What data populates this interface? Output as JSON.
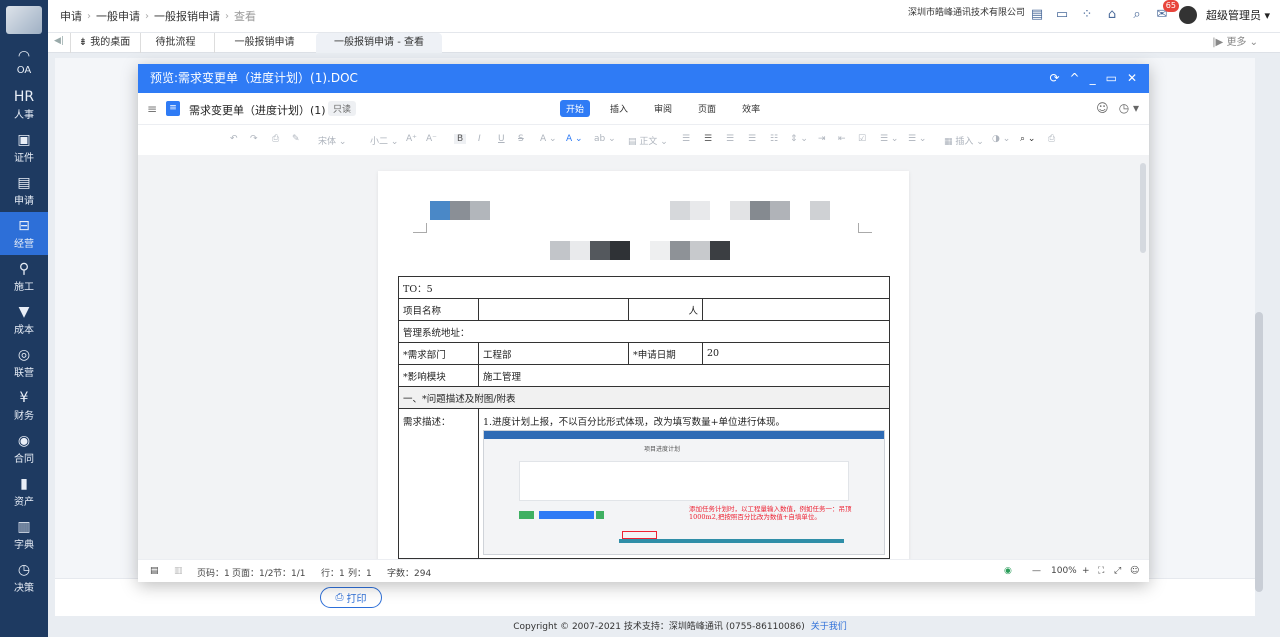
{
  "nav": [
    {
      "label": "OA",
      "icon": "oa-icon"
    },
    {
      "label": "人事",
      "icon": "hr-icon"
    },
    {
      "label": "证件",
      "icon": "certificate-icon"
    },
    {
      "label": "申请",
      "icon": "apply-icon"
    },
    {
      "label": "经营",
      "icon": "business-icon",
      "active": true
    },
    {
      "label": "施工",
      "icon": "construction-icon"
    },
    {
      "label": "成本",
      "icon": "cost-icon"
    },
    {
      "label": "联营",
      "icon": "alliance-icon"
    },
    {
      "label": "财务",
      "icon": "finance-icon"
    },
    {
      "label": "合同",
      "icon": "contract-icon"
    },
    {
      "label": "资产",
      "icon": "asset-icon"
    },
    {
      "label": "字典",
      "icon": "dictionary-icon"
    },
    {
      "label": "决策",
      "icon": "decision-icon"
    }
  ],
  "breadcrumb": [
    "申请",
    "一般申请",
    "一般报销申请",
    "查看"
  ],
  "header": {
    "company": "深圳市皓峰通讯技术有限公司",
    "badge": "65",
    "user": "超级管理员"
  },
  "tabs": [
    "我的桌面",
    "待批流程",
    "一般报销申请",
    "一般报销申请 - 查看"
  ],
  "more": "更多",
  "modal": {
    "title": "预览:需求变更单（进度计划）(1).DOC",
    "doc_name": "需求变更单（进度计划）(1)",
    "readonly": "只读",
    "menu": [
      "开始",
      "插入",
      "审阅",
      "页面",
      "效率"
    ],
    "format": {
      "font": "宋体",
      "size": "小二",
      "para": "正文",
      "insert": "插入"
    }
  },
  "doc": {
    "to": "TO：5",
    "project_name": "项目名称",
    "applicant_suffix": "人",
    "mgmt_address": "管理系统地址：",
    "dept_label": "*需求部门",
    "dept_value": "工程部",
    "date_label": "*申请日期",
    "date_value": "20",
    "module_label": "*影响模块",
    "module_value": "施工管理",
    "section": "一、*问题描述及附图/附表",
    "desc_label": "需求描述：",
    "desc_text": "1.进度计划上报，不以百分比形式体现，改为填写数量+单位进行体现。",
    "shot_title": "项目进度计划",
    "shot_note": "添加任务计划时，以工程量输入数值，例如任务一：吊顶1000m2,把按照百分比改为数值+自填单位。"
  },
  "status": {
    "page": "页码：1",
    "pages": "页面：1/2",
    "section": "节：1/1",
    "row": "行：1",
    "col": "列：1",
    "words": "字数：294",
    "zoom": "100%"
  },
  "print_label": "打印",
  "footer": {
    "copyright": "Copyright © 2007-2021 技术支持：深圳皓峰通讯 (0755-86110086)",
    "about": "关于我们"
  }
}
